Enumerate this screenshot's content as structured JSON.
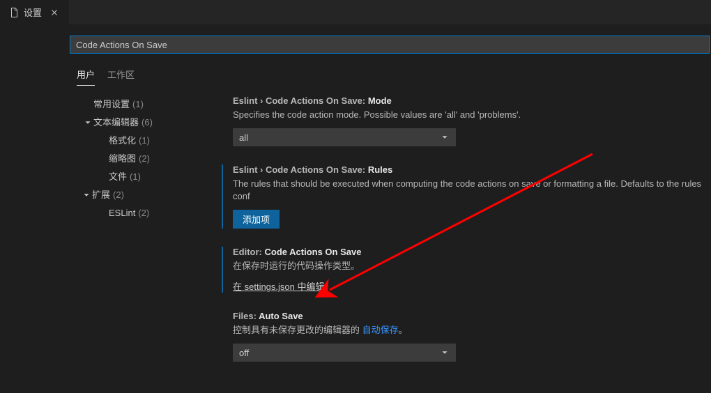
{
  "tab": {
    "title": "设置"
  },
  "search": {
    "value": "Code Actions On Save"
  },
  "scopeTabs": {
    "user": "用户",
    "workspace": "工作区"
  },
  "toc": {
    "common": {
      "label": "常用设置",
      "count": "(1)"
    },
    "textEditor": {
      "label": "文本编辑器",
      "count": "(6)"
    },
    "formatting": {
      "label": "格式化",
      "count": "(1)"
    },
    "minimap": {
      "label": "缩略图",
      "count": "(2)"
    },
    "files": {
      "label": "文件",
      "count": "(1)"
    },
    "extensions": {
      "label": "扩展",
      "count": "(2)"
    },
    "eslint": {
      "label": "ESLint",
      "count": "(2)"
    }
  },
  "settings": {
    "mode": {
      "prefix": "Eslint › Code Actions On Save: ",
      "name": "Mode",
      "desc": "Specifies the code action mode. Possible values are 'all' and 'problems'.",
      "value": "all"
    },
    "rules": {
      "prefix": "Eslint › Code Actions On Save: ",
      "name": "Rules",
      "desc": "The rules that should be executed when computing the code actions on save or formatting a file. Defaults to the rules conf",
      "button": "添加项"
    },
    "editorCodeActions": {
      "prefix": "Editor: ",
      "name": "Code Actions On Save",
      "desc": "在保存时运行的代码操作类型。",
      "link": "在 settings.json 中编辑"
    },
    "autoSave": {
      "prefix": "Files: ",
      "name": "Auto Save",
      "descPre": "控制具有未保存更改的编辑器的 ",
      "descLink": "自动保存",
      "descPost": "。",
      "value": "off"
    }
  }
}
